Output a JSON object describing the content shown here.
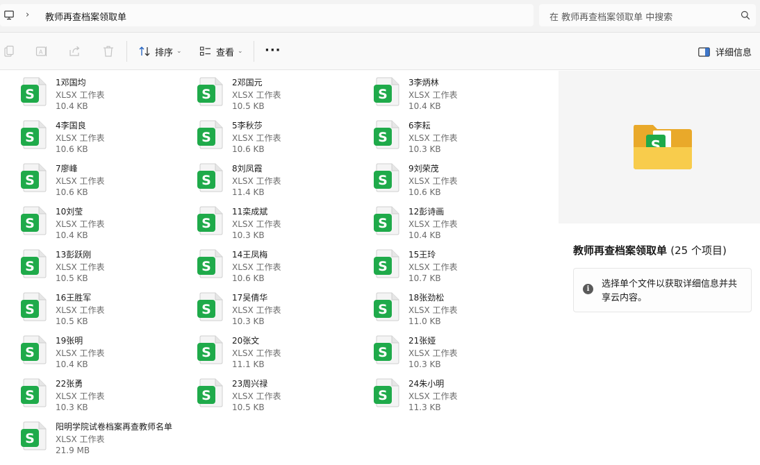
{
  "address": {
    "computer_icon": "computer-icon",
    "separator_icon": "chevron-right-icon",
    "folder": "教师再查档案领取单"
  },
  "search": {
    "placeholder": "在 教师再查档案领取单 中搜索",
    "icon": "search-icon"
  },
  "toolbar": {
    "icons": [
      "copy-icon",
      "rename-icon",
      "share-icon",
      "delete-icon"
    ],
    "sort_label": "排序",
    "view_label": "查看",
    "more_label": "···",
    "details_label": "详细信息"
  },
  "files": [
    {
      "name": "1邓国均",
      "type": "XLSX 工作表",
      "size": "10.4 KB"
    },
    {
      "name": "2邓国元",
      "type": "XLSX 工作表",
      "size": "10.5 KB"
    },
    {
      "name": "3李炳林",
      "type": "XLSX 工作表",
      "size": "10.4 KB"
    },
    {
      "name": "4李国良",
      "type": "XLSX 工作表",
      "size": "10.6 KB"
    },
    {
      "name": "5李秋莎",
      "type": "XLSX 工作表",
      "size": "10.6 KB"
    },
    {
      "name": "6李耘",
      "type": "XLSX 工作表",
      "size": "10.3 KB"
    },
    {
      "name": "7廖峰",
      "type": "XLSX 工作表",
      "size": "10.6 KB"
    },
    {
      "name": "8刘凤霞",
      "type": "XLSX 工作表",
      "size": "11.4 KB"
    },
    {
      "name": "9刘荣茂",
      "type": "XLSX 工作表",
      "size": "10.6 KB"
    },
    {
      "name": "10刘莹",
      "type": "XLSX 工作表",
      "size": "10.4 KB"
    },
    {
      "name": "11栾成斌",
      "type": "XLSX 工作表",
      "size": "10.3 KB"
    },
    {
      "name": "12彭诗画",
      "type": "XLSX 工作表",
      "size": "10.4 KB"
    },
    {
      "name": "13彭跃刚",
      "type": "XLSX 工作表",
      "size": "10.5 KB"
    },
    {
      "name": "14王凤梅",
      "type": "XLSX 工作表",
      "size": "10.6 KB"
    },
    {
      "name": "15王玲",
      "type": "XLSX 工作表",
      "size": "10.7 KB"
    },
    {
      "name": "16王胜军",
      "type": "XLSX 工作表",
      "size": "10.5 KB"
    },
    {
      "name": "17吴倩华",
      "type": "XLSX 工作表",
      "size": "10.3 KB"
    },
    {
      "name": "18张劲松",
      "type": "XLSX 工作表",
      "size": "11.0 KB"
    },
    {
      "name": "19张明",
      "type": "XLSX 工作表",
      "size": "10.4 KB"
    },
    {
      "name": "20张文",
      "type": "XLSX 工作表",
      "size": "11.1 KB"
    },
    {
      "name": "21张娅",
      "type": "XLSX 工作表",
      "size": "10.3 KB"
    },
    {
      "name": "22张勇",
      "type": "XLSX 工作表",
      "size": "10.3 KB"
    },
    {
      "name": "23周兴禄",
      "type": "XLSX 工作表",
      "size": "10.5 KB"
    },
    {
      "name": "24朱小明",
      "type": "XLSX 工作表",
      "size": "11.3 KB"
    },
    {
      "name": "阳明学院试卷档案再查教师名单",
      "type": "XLSX 工作表",
      "size": "21.9 MB"
    }
  ],
  "details": {
    "title": "教师再查档案领取单",
    "count": "(25 个项目)",
    "info_icon": "info-icon",
    "message": "选择单个文件以获取详细信息并共享云内容。"
  },
  "colors": {
    "sheet_green": "#1faa4a",
    "folder_yellow": "#f7c843"
  }
}
